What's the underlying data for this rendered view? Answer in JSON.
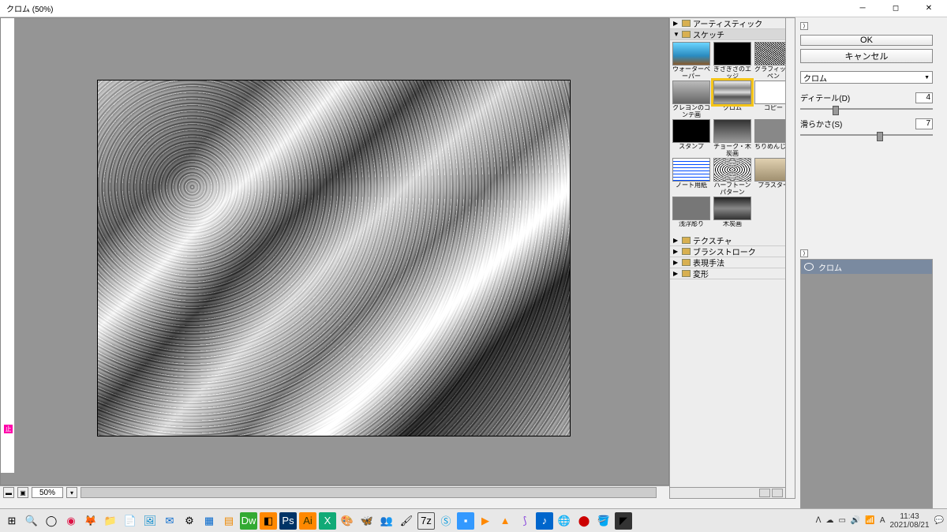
{
  "window": {
    "title": "クロム (50%)",
    "proof_marker": "止"
  },
  "preview": {
    "zoom": "50%"
  },
  "filter_tree": {
    "categories": {
      "artistic": "アーティスティック",
      "sketch": "スケッチ",
      "texture": "テクスチャ",
      "brush": "ブラシストローク",
      "expression": "表現手法",
      "distort": "変形"
    },
    "sketch_filters": [
      {
        "id": "water-paper",
        "label": "ウォーターペーパー",
        "cls": "th-water"
      },
      {
        "id": "torn-edge",
        "label": "ぎざぎざのエッジ",
        "cls": "th-edge"
      },
      {
        "id": "graphic-pen",
        "label": "グラフィックペン",
        "cls": "th-pen"
      },
      {
        "id": "crayon-conte",
        "label": "クレヨンのコンテ画",
        "cls": "th-crayon"
      },
      {
        "id": "chrome",
        "label": "クロム",
        "cls": "th-chrome",
        "selected": true
      },
      {
        "id": "copy",
        "label": "コピー",
        "cls": "th-copy"
      },
      {
        "id": "stamp",
        "label": "スタンプ",
        "cls": "th-stamp"
      },
      {
        "id": "chalk-charcoal",
        "label": "チョーク・木炭画",
        "cls": "th-chalk"
      },
      {
        "id": "crinkle",
        "label": "ちりめんじわ",
        "cls": "th-crumple"
      },
      {
        "id": "note-paper",
        "label": "ノート用紙",
        "cls": "th-note"
      },
      {
        "id": "halftone",
        "label": "ハーフトーンパターン",
        "cls": "th-halftone"
      },
      {
        "id": "plaster",
        "label": "プラスター",
        "cls": "th-plaster"
      },
      {
        "id": "relief",
        "label": "浅浮彫り",
        "cls": "th-relief"
      },
      {
        "id": "charcoal",
        "label": "木炭画",
        "cls": "th-charcoal"
      }
    ]
  },
  "controls": {
    "ok": "OK",
    "cancel": "キャンセル",
    "filter_combo": "クロム",
    "params": {
      "detail": {
        "label": "ディテール(D)",
        "value": "4"
      },
      "smoothness": {
        "label": "滑らかさ(S)",
        "value": "7"
      }
    }
  },
  "effect_stack": {
    "item": "クロム"
  },
  "taskbar": {
    "time": "11:43",
    "date": "2021/08/21"
  }
}
